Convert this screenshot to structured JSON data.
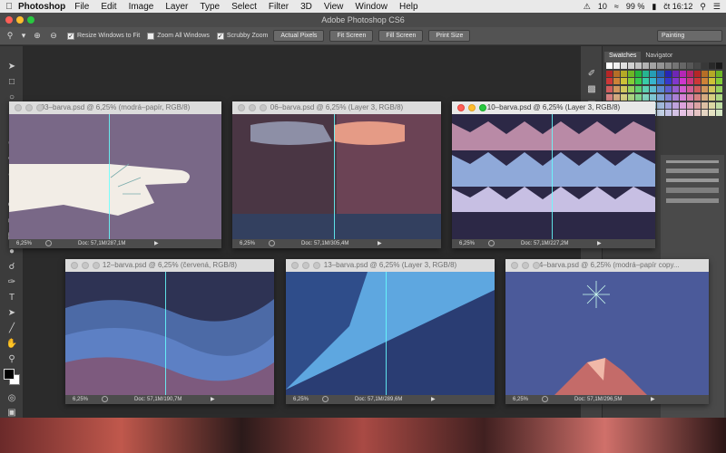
{
  "menubar": {
    "app_name": "Photoshop",
    "items": [
      "File",
      "Edit",
      "Image",
      "Layer",
      "Type",
      "Select",
      "Filter",
      "3D",
      "View",
      "Window",
      "Help"
    ],
    "status": {
      "notifications": "10",
      "battery": "99 %",
      "clock": "čt 16:12"
    }
  },
  "app_title": "Adobe Photoshop CS6",
  "options_bar": {
    "resize_windows": "Resize Windows to Fit",
    "zoom_all": "Zoom All Windows",
    "scrubby": "Scrubby Zoom",
    "actual_pixels": "Actual Pixels",
    "fit_screen": "Fit Screen",
    "fill_screen": "Fill Screen",
    "print_size": "Print Size",
    "workspace": "Painting"
  },
  "panels": {
    "tab_swatches": "Swatches",
    "tab_navigator": "Navigator"
  },
  "documents": [
    {
      "title": "03–barva.psd @ 6,25% (modrá–papír, RGB/8)",
      "zoom": "6,25%",
      "doc": "Doc: 57,1M/287,1M"
    },
    {
      "title": "06–barva.psd @ 6,25% (Layer 3, RGB/8)",
      "zoom": "6,25%",
      "doc": "Doc: 57,1M/305,4M"
    },
    {
      "title": "10–barva.psd @ 6,25% (Layer 3, RGB/8)",
      "zoom": "6,25%",
      "doc": "Doc: 57,1M/227,2M"
    },
    {
      "title": "12–barva.psd @ 6,25% (červená, RGB/8)",
      "zoom": "6,25%",
      "doc": "Doc: 57,1M/190,7M"
    },
    {
      "title": "13–barva.psd @ 6,25% (Layer 3, RGB/8)",
      "zoom": "6,25%",
      "doc": "Doc: 57,1M/289,6M"
    },
    {
      "title": "14–barva.psd @ 6,25% (modrá–papír copy...",
      "zoom": "6,25%",
      "doc": "Doc: 57,1M/296,5M"
    }
  ],
  "colors": {
    "guide": "#66ffff",
    "title_bg": "#dcdcdc",
    "close": "#ff5f57",
    "min": "#ffbd2e",
    "max": "#28c840"
  }
}
